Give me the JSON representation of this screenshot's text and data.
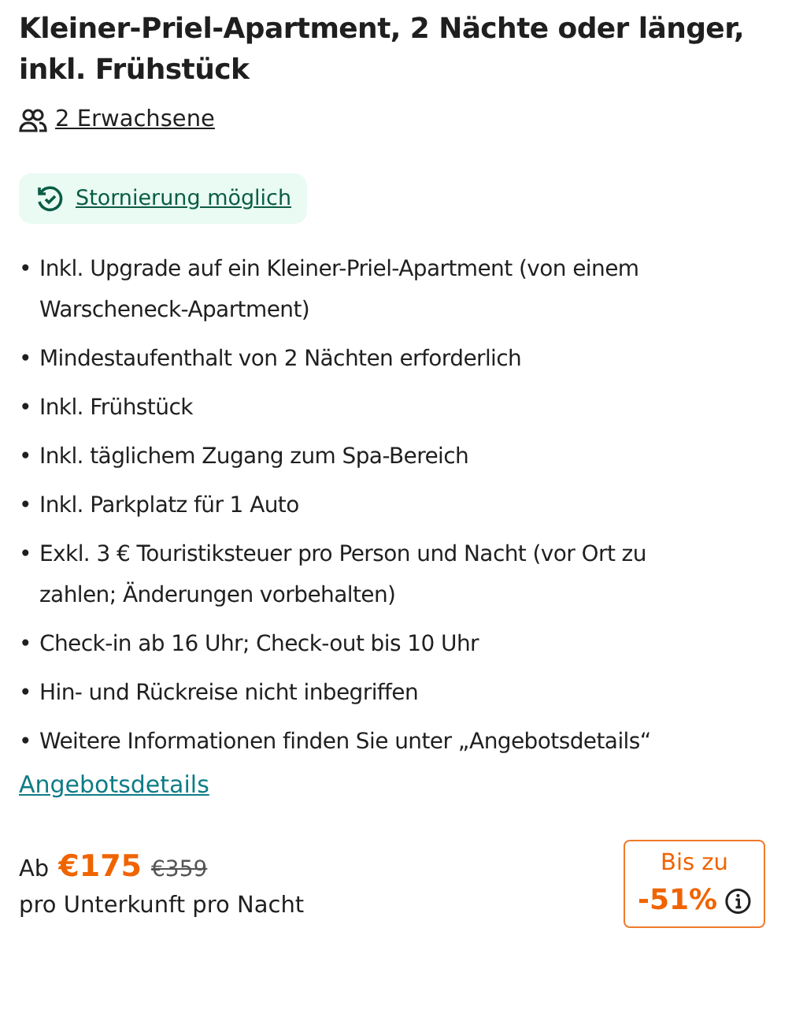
{
  "title": "Kleiner-Priel-Apartment, 2 Nächte oder länger, inkl. Frühstück",
  "guests": "2 Erwachsene",
  "cancellation": "Stornierung möglich",
  "features": [
    {
      "marker": "•",
      "text": "Inkl. Upgrade auf ein Kleiner-Priel-Apartment (von einem Warscheneck-Apartment)"
    },
    {
      "marker": "•",
      "text": "Mindestaufenthalt von 2 Nächten erforderlich"
    },
    {
      "marker": "•",
      "text": "Inkl. Frühstück"
    },
    {
      "marker": "•",
      "text": "Inkl. täglichem Zugang zum Spa-Bereich"
    },
    {
      "marker": "•",
      "text": "Inkl. Parkplatz für 1 Auto"
    },
    {
      "marker": "•",
      "text": "Exkl. 3 € Touristiksteuer pro Person und Nacht (vor Ort zu zahlen; Änderungen vorbehalten)"
    },
    {
      "marker": "•",
      "text": "Check-in ab 16 Uhr; Check-out bis 10 Uhr"
    },
    {
      "marker": "•",
      "text": "Hin- und Rückreise nicht inbegriffen"
    },
    {
      "marker": "•",
      "text": "Weitere Informationen finden Sie unter „Angebotsdetails“"
    }
  ],
  "details_link": "Angebotsdetails",
  "price": {
    "prefix": "Ab",
    "current": "€175",
    "original": "€359",
    "unit": "pro Unterkunft pro Nacht"
  },
  "discount": {
    "label": "Bis zu",
    "value": "-51%"
  }
}
